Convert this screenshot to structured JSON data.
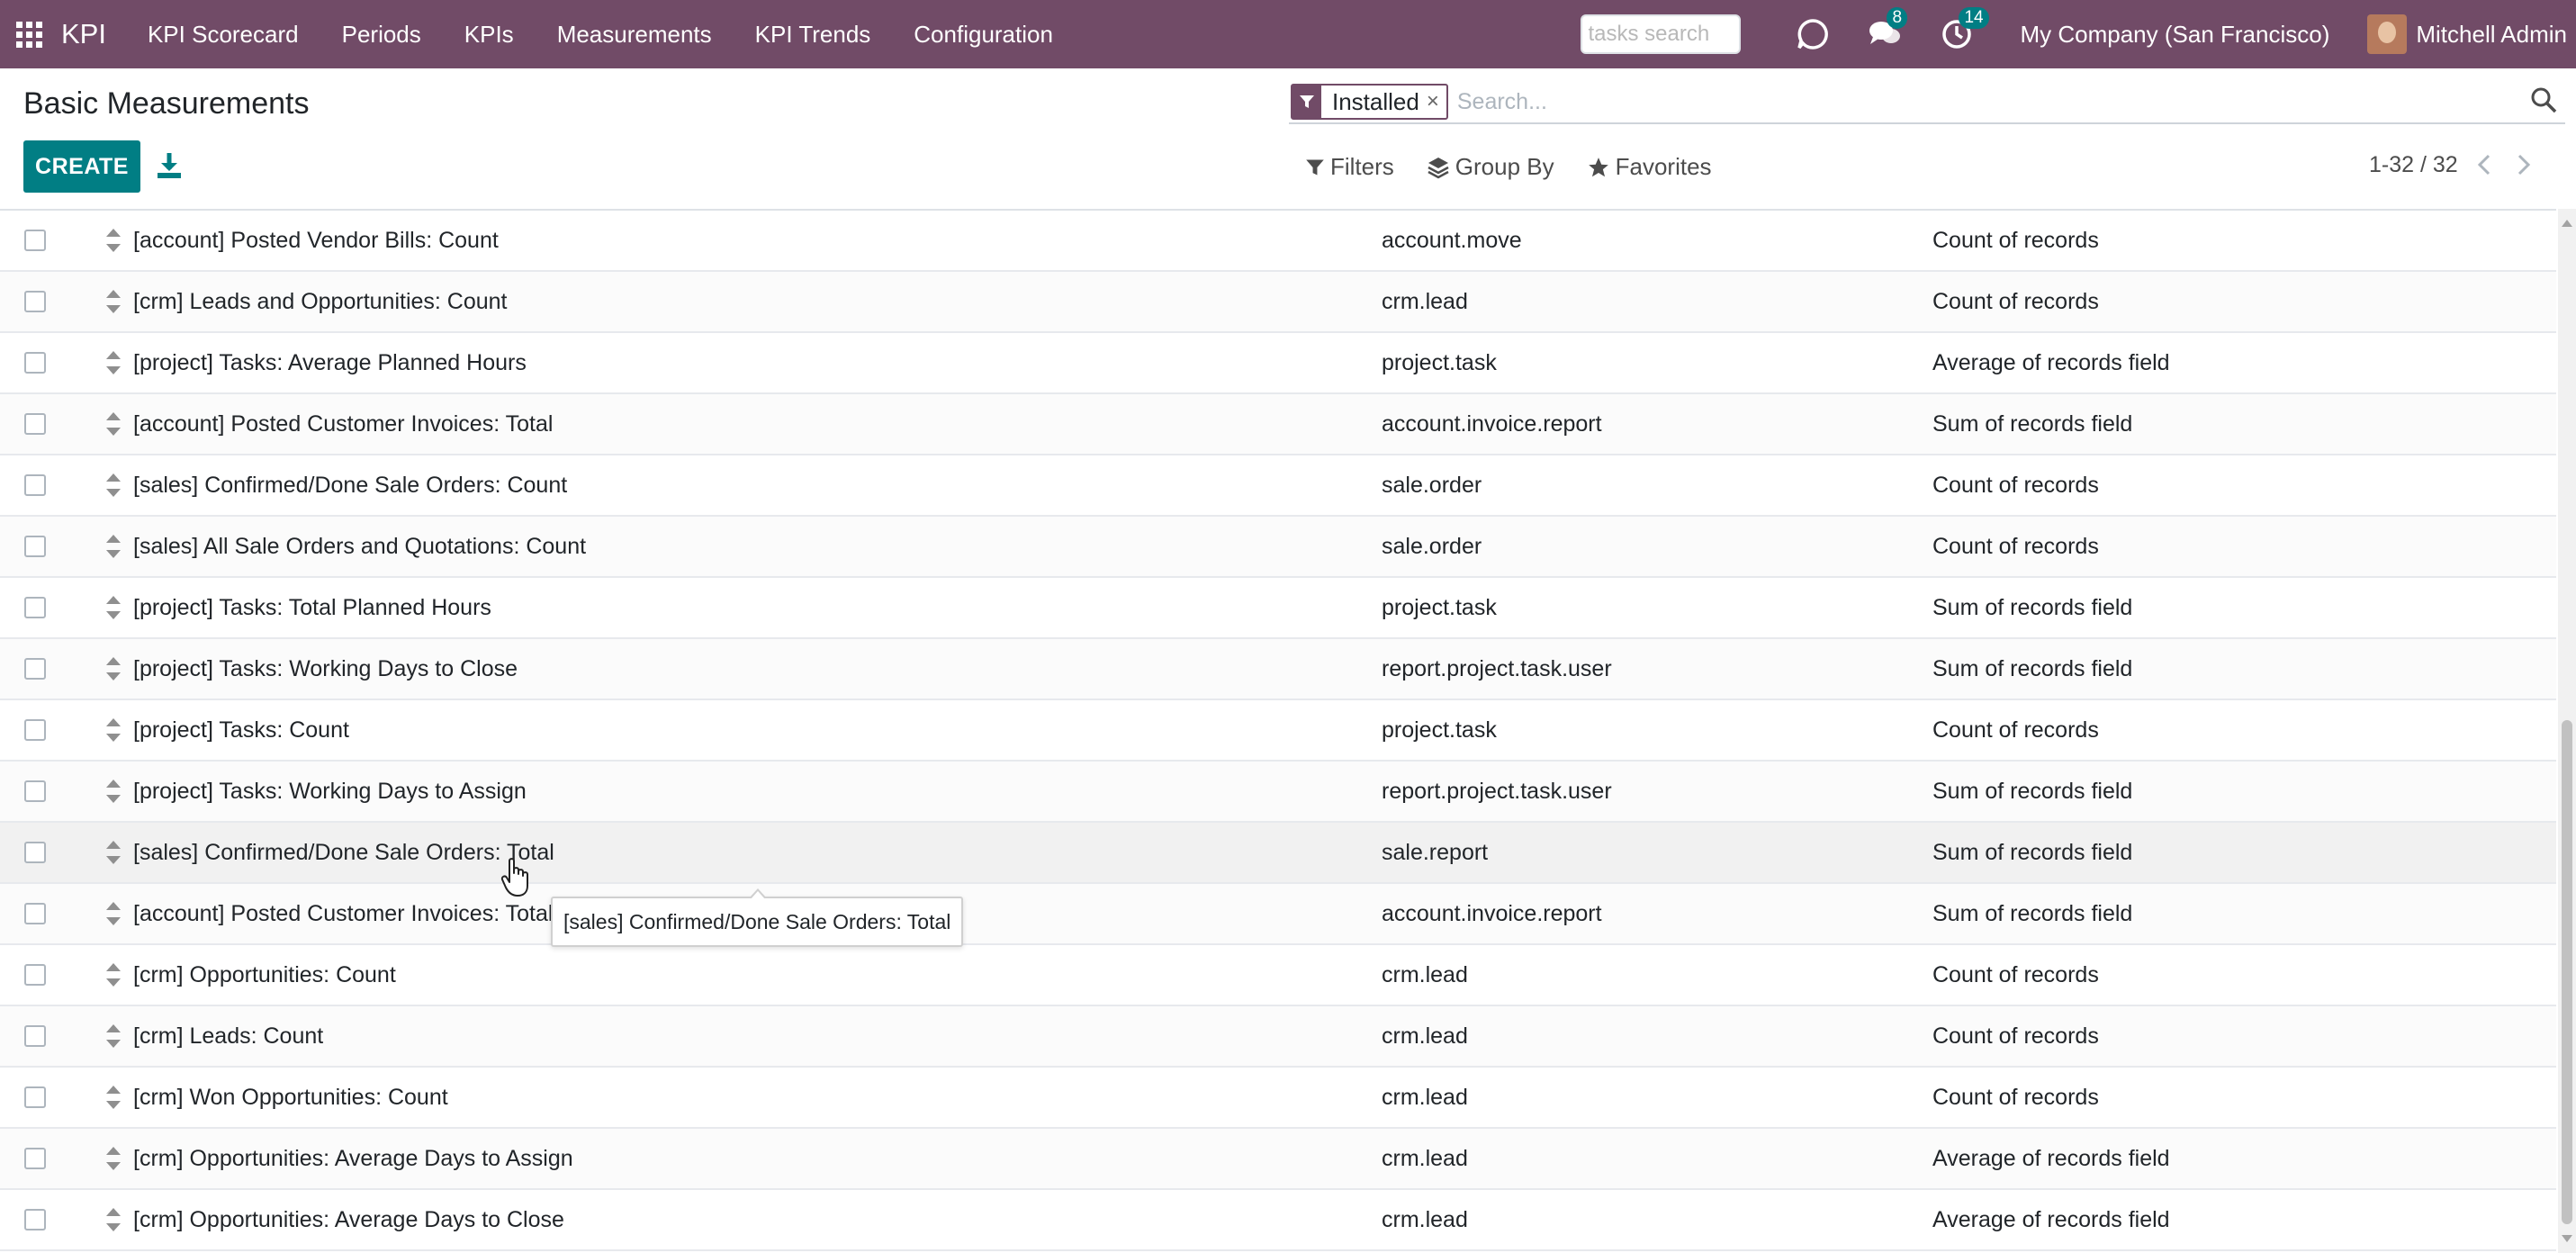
{
  "navbar": {
    "app_name": "KPI",
    "menu": [
      "KPI Scorecard",
      "Periods",
      "KPIs",
      "Measurements",
      "KPI Trends",
      "Configuration"
    ],
    "task_search_placeholder": "tasks search",
    "messages_count": "8",
    "activities_count": "14",
    "company": "My Company (San Francisco)",
    "user": "Mitchell Admin",
    "color": "#714B67"
  },
  "control_panel": {
    "title": "Basic Measurements",
    "create_label": "CREATE",
    "facet_label": "Installed",
    "search_placeholder": "Search...",
    "filters_label": "Filters",
    "group_by_label": "Group By",
    "favorites_label": "Favorites",
    "pager": "1-32 / 32",
    "accent_color": "#017e84"
  },
  "rows": [
    {
      "name": "[account] Posted Vendor Bills: Count",
      "model": "account.move",
      "type": "Count of records"
    },
    {
      "name": "[crm] Leads and Opportunities: Count",
      "model": "crm.lead",
      "type": "Count of records"
    },
    {
      "name": "[project] Tasks: Average Planned Hours",
      "model": "project.task",
      "type": "Average of records field"
    },
    {
      "name": "[account] Posted Customer Invoices: Total",
      "model": "account.invoice.report",
      "type": "Sum of records field"
    },
    {
      "name": "[sales] Confirmed/Done Sale Orders: Count",
      "model": "sale.order",
      "type": "Count of records"
    },
    {
      "name": "[sales] All Sale Orders and Quotations: Count",
      "model": "sale.order",
      "type": "Count of records"
    },
    {
      "name": "[project] Tasks: Total Planned Hours",
      "model": "project.task",
      "type": "Sum of records field"
    },
    {
      "name": "[project] Tasks: Working Days to Close",
      "model": "report.project.task.user",
      "type": "Sum of records field"
    },
    {
      "name": "[project] Tasks: Count",
      "model": "project.task",
      "type": "Count of records"
    },
    {
      "name": "[project] Tasks: Working Days to Assign",
      "model": "report.project.task.user",
      "type": "Sum of records field"
    },
    {
      "name": "[sales] Confirmed/Done Sale Orders: Total",
      "model": "sale.report",
      "type": "Sum of records field"
    },
    {
      "name": "[account] Posted Customer Invoices: Total",
      "model": "account.invoice.report",
      "type": "Sum of records field"
    },
    {
      "name": "[crm] Opportunities: Count",
      "model": "crm.lead",
      "type": "Count of records"
    },
    {
      "name": "[crm] Leads: Count",
      "model": "crm.lead",
      "type": "Count of records"
    },
    {
      "name": "[crm] Won Opportunities: Count",
      "model": "crm.lead",
      "type": "Count of records"
    },
    {
      "name": "[crm] Opportunities: Average Days to Assign",
      "model": "crm.lead",
      "type": "Average of records field"
    },
    {
      "name": "[crm] Opportunities: Average Days to Close",
      "model": "crm.lead",
      "type": "Average of records field"
    }
  ],
  "tooltip": {
    "text": "[sales] Confirmed/Done Sale Orders: Total"
  }
}
